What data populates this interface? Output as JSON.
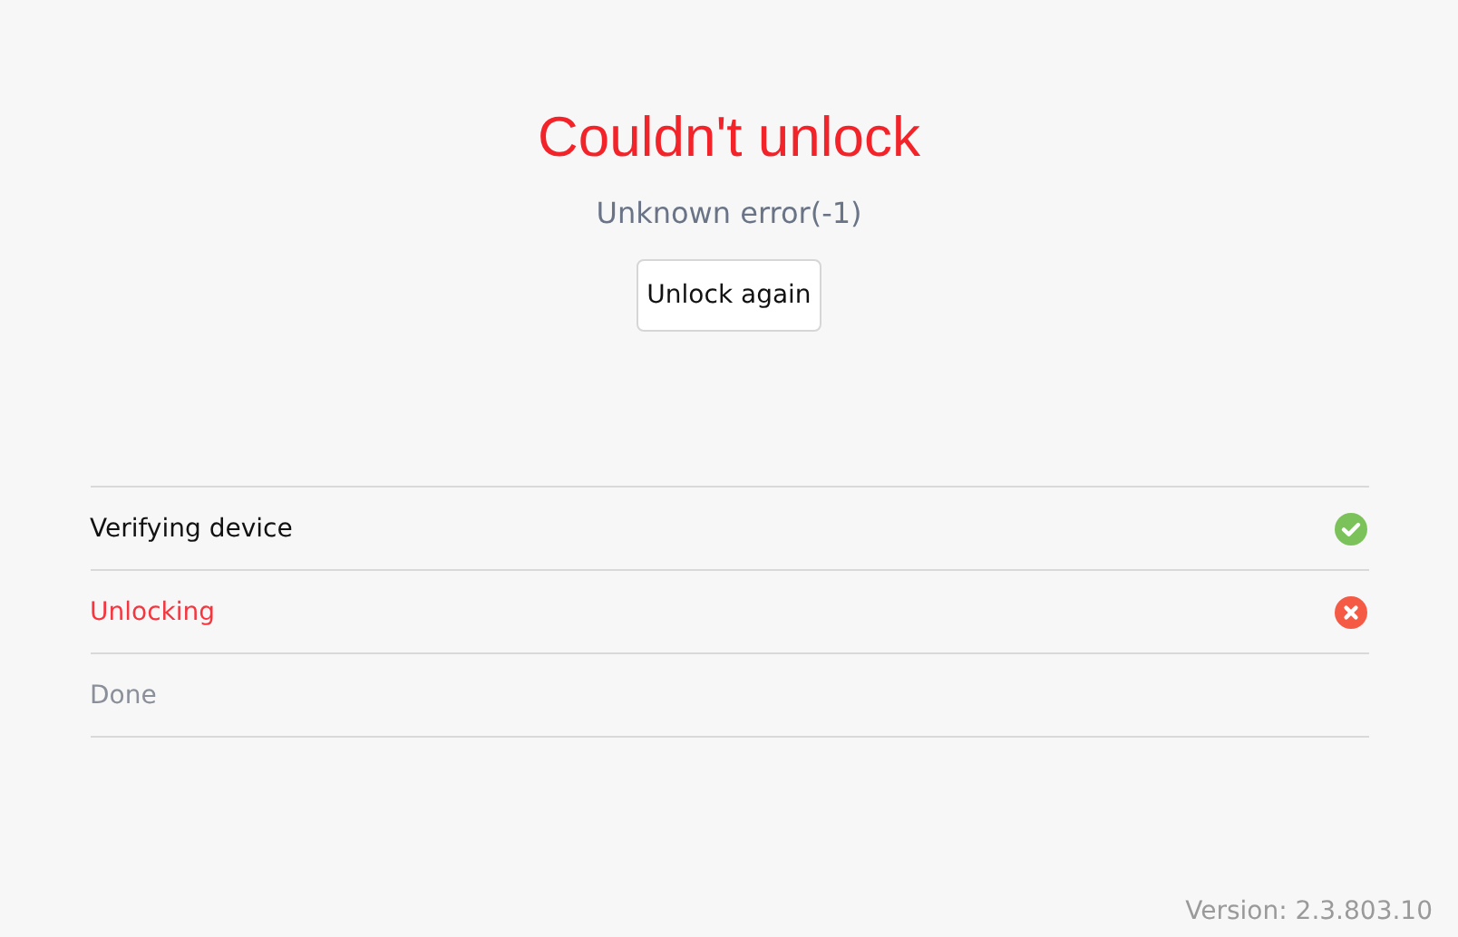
{
  "title": "Couldn't unlock",
  "message": "Unknown error(-1)",
  "button": "Unlock again",
  "steps": [
    {
      "label": "Verifying device",
      "kind": "success"
    },
    {
      "label": "Unlocking",
      "kind": "failed"
    },
    {
      "label": "Done",
      "kind": "pending"
    }
  ],
  "version": "Version: 2.3.803.10"
}
